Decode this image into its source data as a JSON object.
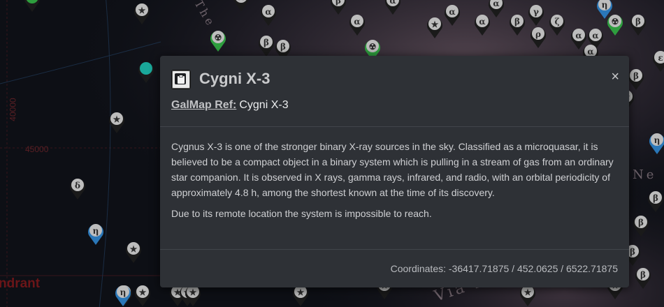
{
  "map": {
    "region_label": "ndrant",
    "grid_labels": [
      "40000",
      "45000"
    ],
    "faint_labels": [
      "The",
      "Via M",
      "Ne"
    ],
    "markers": [
      {
        "glyph": "★",
        "color": "#bdbdbd"
      },
      {
        "glyph": "★",
        "color": "#bdbdbd"
      },
      {
        "glyph": "★",
        "color": "#bdbdbd"
      },
      {
        "glyph": "δ",
        "color": "#bdbdbd"
      },
      {
        "glyph": "η",
        "color": "#bdbdbd",
        "ring": "#2a77b8"
      },
      {
        "glyph": "★",
        "color": "#bdbdbd"
      },
      {
        "glyph": "η",
        "color": "#bdbdbd",
        "ring": "#2a77b8"
      },
      {
        "glyph": "★",
        "color": "#bdbdbd"
      },
      {
        "glyph": "★",
        "color": "#bdbdbd"
      },
      {
        "glyph": "★",
        "color": "#bdbdbd"
      },
      {
        "glyph": "",
        "color": "#1aa89a"
      },
      {
        "glyph": "☢",
        "color": "#bdbdbd",
        "ring": "#2e9e3e"
      },
      {
        "glyph": "",
        "color": "#2e9e3e"
      },
      {
        "glyph": "★",
        "color": "#bdbdbd"
      },
      {
        "glyph": "β",
        "color": "#bdbdbd"
      },
      {
        "glyph": "β",
        "color": "#bdbdbd"
      },
      {
        "glyph": "α",
        "color": "#bdbdbd"
      },
      {
        "glyph": "β",
        "color": "#bdbdbd"
      },
      {
        "glyph": "α",
        "color": "#bdbdbd"
      },
      {
        "glyph": "α",
        "color": "#bdbdbd"
      },
      {
        "glyph": "★",
        "color": "#bdbdbd"
      },
      {
        "glyph": "☢",
        "color": "#bdbdbd",
        "ring": "#2e9e3e"
      },
      {
        "glyph": "α",
        "color": "#bdbdbd"
      },
      {
        "glyph": "α",
        "color": "#bdbdbd"
      },
      {
        "glyph": "β",
        "color": "#bdbdbd"
      },
      {
        "glyph": "γ",
        "color": "#bdbdbd"
      },
      {
        "glyph": "ζ",
        "color": "#bdbdbd"
      },
      {
        "glyph": "η",
        "color": "#bdbdbd",
        "ring": "#2a77b8"
      },
      {
        "glyph": "☢",
        "color": "#bdbdbd",
        "ring": "#2e9e3e"
      },
      {
        "glyph": "α",
        "color": "#bdbdbd"
      },
      {
        "glyph": "β",
        "color": "#bdbdbd"
      },
      {
        "glyph": "ε",
        "color": "#bdbdbd"
      },
      {
        "glyph": "η",
        "color": "#bdbdbd",
        "ring": "#2a77b8"
      },
      {
        "glyph": "β",
        "color": "#bdbdbd"
      },
      {
        "glyph": "β",
        "color": "#bdbdbd"
      },
      {
        "glyph": "β",
        "color": "#bdbdbd"
      },
      {
        "glyph": "β",
        "color": "#bdbdbd"
      },
      {
        "glyph": "β",
        "color": "#bdbdbd"
      },
      {
        "glyph": "★",
        "color": "#bdbdbd"
      },
      {
        "glyph": "α",
        "color": "#bdbdbd"
      },
      {
        "glyph": "★",
        "color": "#bdbdbd"
      },
      {
        "glyph": "★",
        "color": "#bdbdbd"
      },
      {
        "glyph": "★",
        "color": "#bdbdbd"
      },
      {
        "glyph": "★",
        "color": "#bdbdbd"
      },
      {
        "glyph": "α",
        "color": "#bdbdbd"
      },
      {
        "glyph": "α",
        "color": "#bdbdbd"
      },
      {
        "glyph": "ρ",
        "color": "#bdbdbd"
      },
      {
        "glyph": "★",
        "color": "#bdbdbd"
      }
    ]
  },
  "modal": {
    "title": "Cygni X-3",
    "type_icon": "clipboard-icon",
    "close_glyph": "×",
    "ref_label": "GalMap Ref:",
    "ref_value": "Cygni X-3",
    "paragraphs": [
      "Cygnus X-3 is one of the stronger binary X-ray sources in the sky. Classified as a microquasar, it is believed to be a compact object in a binary system which is pulling in a stream of gas from an ordinary star companion. It is observed in X rays, gamma rays, infrared, and radio, with an orbital periodicity of approximately 4.8 h, among the shortest known at the time of its discovery.",
      "Due to its remote location the system is impossible to reach."
    ],
    "coordinates": "Coordinates: -36417.71875 / 452.0625 / 6522.71875"
  }
}
